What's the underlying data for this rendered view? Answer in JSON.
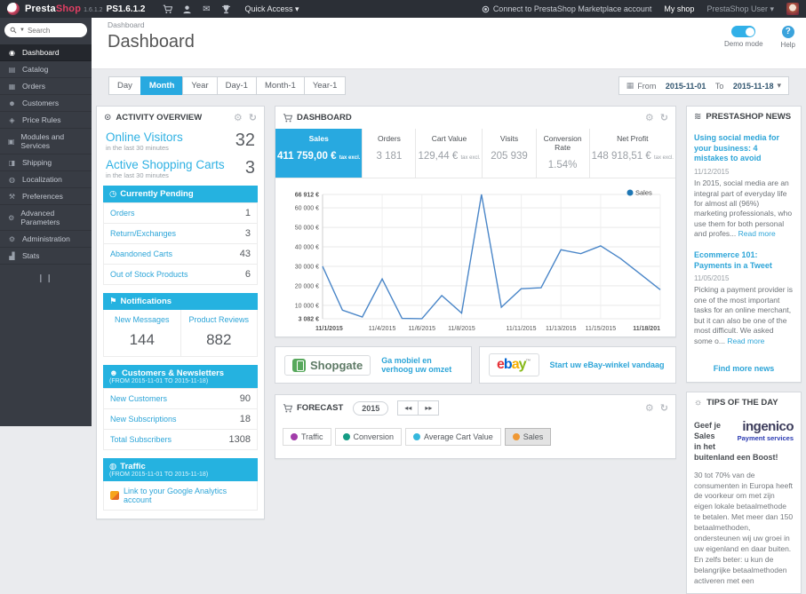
{
  "colors": {
    "accent": "#28a9e0",
    "section_blue": "#25b2e0",
    "link_blue": "#2da5d8"
  },
  "topbar": {
    "brand_presta": "Presta",
    "brand_shop": "Shop",
    "version": "1.6.1.2",
    "shop_code": "PS1.6.1.2",
    "quick_access": "Quick Access ▾",
    "marketplace": "Connect to PrestaShop Marketplace account",
    "my_shop": "My shop",
    "user": "PrestaShop User ▾"
  },
  "sidebar": {
    "search_placeholder": "Search",
    "items": [
      {
        "label": "Dashboard",
        "icon": "gauge-icon",
        "glyph": "◉",
        "active": true
      },
      {
        "label": "Catalog",
        "icon": "book-icon",
        "glyph": "▤",
        "active": false
      },
      {
        "label": "Orders",
        "icon": "orders-icon",
        "glyph": "▦",
        "active": false
      },
      {
        "label": "Customers",
        "icon": "customers-icon",
        "glyph": "☻",
        "active": false
      },
      {
        "label": "Price Rules",
        "icon": "price-tag-icon",
        "glyph": "◈",
        "active": false
      },
      {
        "label": "Modules and Services",
        "icon": "modules-icon",
        "glyph": "▣",
        "active": false
      },
      {
        "label": "Shipping",
        "icon": "truck-icon",
        "glyph": "◨",
        "active": false
      },
      {
        "label": "Localization",
        "icon": "globe-icon",
        "glyph": "◍",
        "active": false
      },
      {
        "label": "Preferences",
        "icon": "wrench-icon",
        "glyph": "⚒",
        "active": false
      },
      {
        "label": "Advanced Parameters",
        "icon": "gears-icon",
        "glyph": "⚙",
        "active": false
      },
      {
        "label": "Administration",
        "icon": "cog-icon",
        "glyph": "⚙",
        "active": false
      },
      {
        "label": "Stats",
        "icon": "stats-icon",
        "glyph": "▟",
        "active": false
      }
    ]
  },
  "header": {
    "breadcrumb": "Dashboard",
    "title": "Dashboard",
    "demo_mode": "Demo mode",
    "help": "Help"
  },
  "toolbar": {
    "ranges": [
      "Day",
      "Month",
      "Year",
      "Day-1",
      "Month-1",
      "Year-1"
    ],
    "active_range": "Month",
    "from_label": "From",
    "date_from": "2015-11-01",
    "to_label": "To",
    "date_to": "2015-11-18",
    "caret": "▾"
  },
  "activity": {
    "title": "ACTIVITY OVERVIEW",
    "online_visitors_label": "Online Visitors",
    "online_visitors_value": "32",
    "online_visitors_sub": "in the last 30 minutes",
    "carts_label": "Active Shopping Carts",
    "carts_value": "3",
    "carts_sub": "in the last 30 minutes",
    "pending": {
      "title": "Currently Pending",
      "rows": [
        {
          "label": "Orders",
          "value": "1"
        },
        {
          "label": "Return/Exchanges",
          "value": "3"
        },
        {
          "label": "Abandoned Carts",
          "value": "43"
        },
        {
          "label": "Out of Stock Products",
          "value": "6"
        }
      ]
    },
    "notifications": {
      "title": "Notifications",
      "cells": [
        {
          "label": "New Messages",
          "value": "144"
        },
        {
          "label": "Product Reviews",
          "value": "882"
        }
      ]
    },
    "customers": {
      "title": "Customers & Newsletters",
      "subtitle": "(FROM 2015-11-01 TO 2015-11-18)",
      "rows": [
        {
          "label": "New Customers",
          "value": "90"
        },
        {
          "label": "New Subscriptions",
          "value": "18"
        },
        {
          "label": "Total Subscribers",
          "value": "1308"
        }
      ]
    },
    "traffic": {
      "title": "Traffic",
      "subtitle": "(FROM 2015-11-01 TO 2015-11-18)",
      "link": "Link to your Google Analytics account"
    }
  },
  "dashboard_panel": {
    "title": "DASHBOARD",
    "kpis": [
      {
        "label": "Sales",
        "value": "411 759,00 €",
        "suffix": "tax excl.",
        "active": true
      },
      {
        "label": "Orders",
        "value": "3 181",
        "suffix": "",
        "active": false
      },
      {
        "label": "Cart Value",
        "value": "129,44 €",
        "suffix": "tax excl.",
        "active": false
      },
      {
        "label": "Visits",
        "value": "205 939",
        "suffix": "",
        "active": false
      },
      {
        "label": "Conversion Rate",
        "value": "1.54%",
        "suffix": "",
        "active": false
      },
      {
        "label": "Net Profit",
        "value": "148 918,51 €",
        "suffix": "tax excl.",
        "active": false
      }
    ]
  },
  "chart_data": {
    "type": "line",
    "title": "Sales by day",
    "x": [
      "11/1/2015",
      "11/2/2015",
      "11/3/2015",
      "11/4/2015",
      "11/5/2015",
      "11/6/2015",
      "11/7/2015",
      "11/8/2015",
      "11/9/2015",
      "11/10/2015",
      "11/11/2015",
      "11/12/2015",
      "11/13/2015",
      "11/14/2015",
      "11/15/2015",
      "11/16/2015",
      "11/17/2015",
      "11/18/2015"
    ],
    "series": [
      {
        "name": "Sales",
        "color": "#4a86c8",
        "values": [
          30000,
          7500,
          4000,
          23500,
          3300,
          3100,
          15000,
          6000,
          66912,
          9000,
          18500,
          19000,
          38500,
          36500,
          40500,
          34000,
          26000,
          18000
        ]
      }
    ],
    "ylim": [
      3082,
      66912
    ],
    "y_ticks": [
      3082,
      10000,
      20000,
      30000,
      40000,
      50000,
      60000,
      66912
    ],
    "y_tick_labels": [
      "3 082 €",
      "10 000 €",
      "20 000 €",
      "30 000 €",
      "40 000 €",
      "50 000 €",
      "60 000 €",
      "66 912 €"
    ],
    "x_tick_indices": [
      0,
      3,
      5,
      7,
      10,
      12,
      14,
      17
    ],
    "x_tick_labels": [
      "11/1/2015",
      "11/4/2015",
      "11/6/2015",
      "11/8/2015",
      "11/11/2015",
      "11/13/2015",
      "11/15/2015",
      "11/18/201"
    ],
    "grid": true,
    "legend_position": "top-right"
  },
  "promos": [
    {
      "name": "Shopgate",
      "logo_text": "Shopgate",
      "link": "Ga mobiel en verhoog uw omzet"
    },
    {
      "name": "eBay",
      "logo_text": "ebay",
      "tm": "™",
      "letter_colors": [
        "#e53238",
        "#0064d2",
        "#f5af02",
        "#86b817"
      ],
      "link": "Start uw eBay-winkel vandaag"
    }
  ],
  "forecast": {
    "title": "FORECAST",
    "year": "2015",
    "prev": "◂◂",
    "next": "▸▸",
    "legend": [
      {
        "label": "Traffic",
        "color": "#a23daa",
        "active": false
      },
      {
        "label": "Conversion",
        "color": "#159c84",
        "active": false
      },
      {
        "label": "Average Cart Value",
        "color": "#35b8dd",
        "active": false
      },
      {
        "label": "Sales",
        "color": "#ef9834",
        "active": true
      }
    ]
  },
  "news": {
    "title": "PRESTASHOP NEWS",
    "articles": [
      {
        "title": "Using social media for your business: 4 mistakes to avoid",
        "date": "11/12/2015",
        "excerpt": "In 2015, social media are an integral part of everyday life for almost all (96%) marketing professionals, who use them for both personal and profes...",
        "read_more": "Read more"
      },
      {
        "title": "Ecommerce 101: Payments in a Tweet",
        "date": "11/05/2015",
        "excerpt": "Picking a payment provider is one of the most important tasks for an online merchant, but it can also be one of the most difficult. We asked some o...",
        "read_more": "Read more"
      }
    ],
    "more": "Find more news"
  },
  "tips": {
    "title": "TIPS OF THE DAY",
    "heading": "Geef je Sales in het buitenland een Boost!",
    "logo_main": "ingenico",
    "logo_sub": "Payment services",
    "body": "30 tot 70% van de consumenten in Europa heeft de voorkeur om met zijn eigen lokale betaalmethode te betalen. Met meer dan 150 betaalmethoden, ondersteunen wij uw groei in uw eigenland en daar buiten. En zelfs beter: u kun de belangrijke betaalmethoden activeren met een"
  }
}
